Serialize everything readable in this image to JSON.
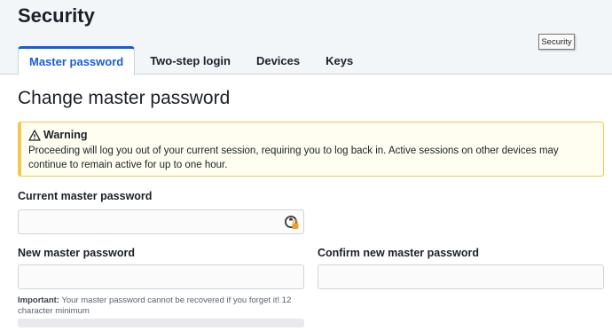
{
  "page": {
    "title": "Security",
    "tooltip": "Security"
  },
  "tabs": [
    {
      "label": "Master password",
      "active": true
    },
    {
      "label": "Two-step login",
      "active": false
    },
    {
      "label": "Devices",
      "active": false
    },
    {
      "label": "Keys",
      "active": false
    }
  ],
  "main": {
    "title": "Change master password",
    "warning": {
      "heading": "Warning",
      "body": "Proceeding will log you out of your current session, requiring you to log back in. Active sessions on other devices may continue to remain active for up to one hour."
    },
    "current_password": {
      "label": "Current master password",
      "value": "",
      "placeholder": ""
    },
    "new_password": {
      "label": "New master password",
      "value": "",
      "placeholder": ""
    },
    "confirm_password": {
      "label": "Confirm new master password",
      "value": "",
      "placeholder": ""
    },
    "hint": {
      "important_label": "Important:",
      "text": "Your master password cannot be recovered if you forget it! 12 character minimum"
    },
    "strength_meter": {
      "level": 0
    }
  },
  "colors": {
    "accent": "#175ddc",
    "warning_border": "#f2c94c",
    "warning_bg": "#fffef1"
  }
}
